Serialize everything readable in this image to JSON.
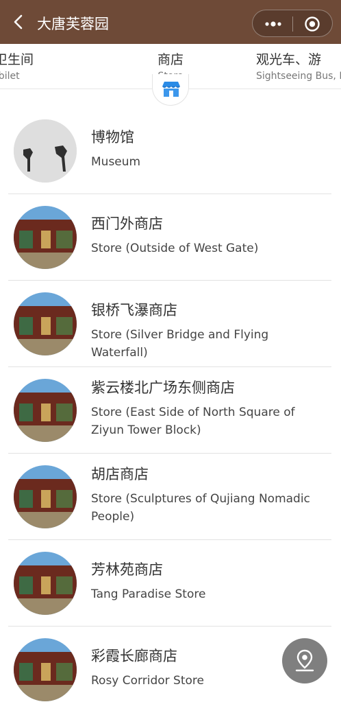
{
  "header": {
    "title": "大唐芙蓉园"
  },
  "tabs": [
    {
      "zh": "卫生间",
      "en": "Toilet"
    },
    {
      "zh": "商店",
      "en": "Store"
    },
    {
      "zh": "观光车、游",
      "en": "Sightseeing Bus, Pl"
    }
  ],
  "items": [
    {
      "zh": "博物馆",
      "en": "Museum"
    },
    {
      "zh": "西门外商店",
      "en": "Store (Outside of West Gate)"
    },
    {
      "zh": "银桥飞瀑商店",
      "en": "Store (Silver Bridge and Flying Waterfall)"
    },
    {
      "zh": "紫云楼北广场东侧商店",
      "en": "Store (East Side of North Square of Ziyun Tower Block)"
    },
    {
      "zh": "胡店商店",
      "en": "Store (Sculptures of Qujiang Nomadic People)"
    },
    {
      "zh": "芳林苑商店",
      "en": "Tang Paradise Store"
    },
    {
      "zh": "彩霞长廊商店",
      "en": "Rosy Corridor Store"
    }
  ],
  "colors": {
    "header_bg": "#6e4a37",
    "store_icon_blue": "#2a8be6",
    "fab_bg": "#7f7f7f"
  },
  "icons": {
    "back": "chevron-left-icon",
    "menu": "more-dots-icon",
    "close": "target-icon",
    "store": "store-icon",
    "locate": "location-pin-icon"
  }
}
